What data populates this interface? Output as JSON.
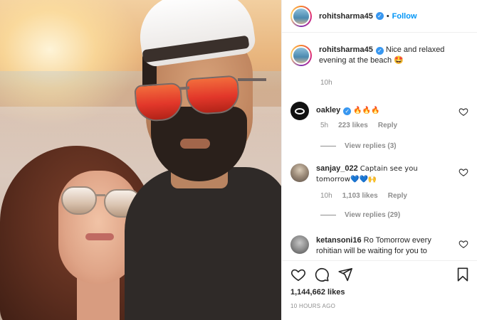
{
  "header": {
    "username": "rohitsharma45",
    "separator": "•",
    "follow_label": "Follow"
  },
  "caption": {
    "username": "rohitsharma45",
    "text": "Nice and relaxed evening at the beach 🤩",
    "time": "10h"
  },
  "comments": [
    {
      "username": "oakley",
      "text": "🔥🔥🔥",
      "time": "5h",
      "likes": "223 likes",
      "reply_label": "Reply",
      "view_replies": "View replies (3)",
      "verified": true
    },
    {
      "username": "sanjay_022",
      "text": "Captain see you tomorrow💙💙🙌",
      "time": "10h",
      "likes": "1,103 likes",
      "reply_label": "Reply",
      "view_replies": "View replies (29)",
      "verified": false
    },
    {
      "username": "ketansoni16",
      "text": "Ro Tomorrow every rohitian will be waiting for you to",
      "verified": false
    }
  ],
  "actions": {
    "icons": [
      "heart-icon",
      "comment-icon",
      "share-icon",
      "bookmark-icon"
    ],
    "likes_count": "1,144,662 likes",
    "posted_ago": "10 HOURS AGO"
  },
  "colors": {
    "accent": "#0095f6",
    "verified": "#3897f0",
    "muted": "#8e8e8e",
    "text": "#262626"
  }
}
